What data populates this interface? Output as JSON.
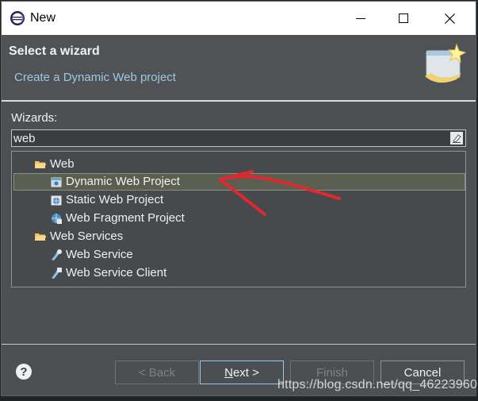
{
  "window": {
    "title": "New",
    "icon": "eclipse-new-icon",
    "controls": [
      "minimize-icon",
      "maximize-icon",
      "close-icon"
    ]
  },
  "banner": {
    "title": "Select a wizard",
    "subtitle": "Create a Dynamic Web project",
    "image": "wizard-banner-icon"
  },
  "wizards": {
    "label": "Wizards:",
    "filter_value": "web",
    "clear_icon": "clear-filter-icon",
    "tree": [
      {
        "label": "Web",
        "type": "category",
        "expanded": true,
        "icon": "folder-open-icon"
      },
      {
        "label": "Dynamic Web Project",
        "type": "item",
        "selected": true,
        "icon": "dynamic-web-project-icon"
      },
      {
        "label": "Static Web Project",
        "type": "item",
        "icon": "static-web-project-icon"
      },
      {
        "label": "Web Fragment Project",
        "type": "item",
        "icon": "web-fragment-project-icon"
      },
      {
        "label": "Web Services",
        "type": "category",
        "expanded": true,
        "icon": "folder-open-icon"
      },
      {
        "label": "Web Service",
        "type": "item",
        "icon": "web-service-icon"
      },
      {
        "label": "Web Service Client",
        "type": "item",
        "icon": "web-service-client-icon"
      }
    ]
  },
  "buttons": {
    "help": "?",
    "back": "< Back",
    "next_prefix": "N",
    "next_rest": "ext >",
    "finish": "Finish",
    "cancel": "Cancel"
  },
  "watermark": "https://blog.csdn.net/qq_46223960",
  "colors": {
    "dialog_bg": "#4c5053",
    "selection": "#5b5f52",
    "subtitle": "#9fc7de",
    "annotation_arrow": "#e0292f"
  }
}
